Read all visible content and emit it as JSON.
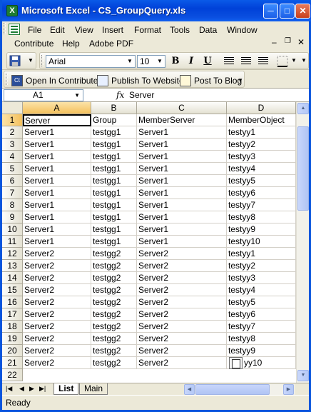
{
  "window": {
    "title": "Microsoft Excel - CS_GroupQuery.xls"
  },
  "menu": {
    "items": [
      "File",
      "Edit",
      "View",
      "Insert",
      "Format",
      "Tools",
      "Data",
      "Window",
      "Contribute",
      "Help",
      "Adobe PDF"
    ]
  },
  "toolbar": {
    "font_name": "Arial",
    "font_size": "10",
    "bold": "B",
    "italic": "I",
    "underline": "U"
  },
  "contribute_bar": {
    "open": "Open In Contribute",
    "publish": "Publish To Website",
    "post": "Post To Blog"
  },
  "formula_bar": {
    "cell_ref": "A1",
    "fx": "fx",
    "value": "Server"
  },
  "grid": {
    "columns": [
      "A",
      "B",
      "C",
      "D"
    ],
    "rows": [
      [
        "Server",
        "Group",
        "MemberServer",
        "MemberObject"
      ],
      [
        "Server1",
        "testgg1",
        "Server1",
        "testyy1"
      ],
      [
        "Server1",
        "testgg1",
        "Server1",
        "testyy2"
      ],
      [
        "Server1",
        "testgg1",
        "Server1",
        "testyy3"
      ],
      [
        "Server1",
        "testgg1",
        "Server1",
        "testyy4"
      ],
      [
        "Server1",
        "testgg1",
        "Server1",
        "testyy5"
      ],
      [
        "Server1",
        "testgg1",
        "Server1",
        "testyy6"
      ],
      [
        "Server1",
        "testgg1",
        "Server1",
        "testyy7"
      ],
      [
        "Server1",
        "testgg1",
        "Server1",
        "testyy8"
      ],
      [
        "Server1",
        "testgg1",
        "Server1",
        "testyy9"
      ],
      [
        "Server1",
        "testgg1",
        "Server1",
        "testyy10"
      ],
      [
        "Server2",
        "testgg2",
        "Server2",
        "testyy1"
      ],
      [
        "Server2",
        "testgg2",
        "Server2",
        "testyy2"
      ],
      [
        "Server2",
        "testgg2",
        "Server2",
        "testyy3"
      ],
      [
        "Server2",
        "testgg2",
        "Server2",
        "testyy4"
      ],
      [
        "Server2",
        "testgg2",
        "Server2",
        "testyy5"
      ],
      [
        "Server2",
        "testgg2",
        "Server2",
        "testyy6"
      ],
      [
        "Server2",
        "testgg2",
        "Server2",
        "testyy7"
      ],
      [
        "Server2",
        "testgg2",
        "Server2",
        "testyy8"
      ],
      [
        "Server2",
        "testgg2",
        "Server2",
        "testyy9"
      ],
      [
        "Server2",
        "testgg2",
        "Server2",
        "yy10"
      ]
    ]
  },
  "sheet_tabs": [
    "List",
    "Main"
  ],
  "status": "Ready"
}
